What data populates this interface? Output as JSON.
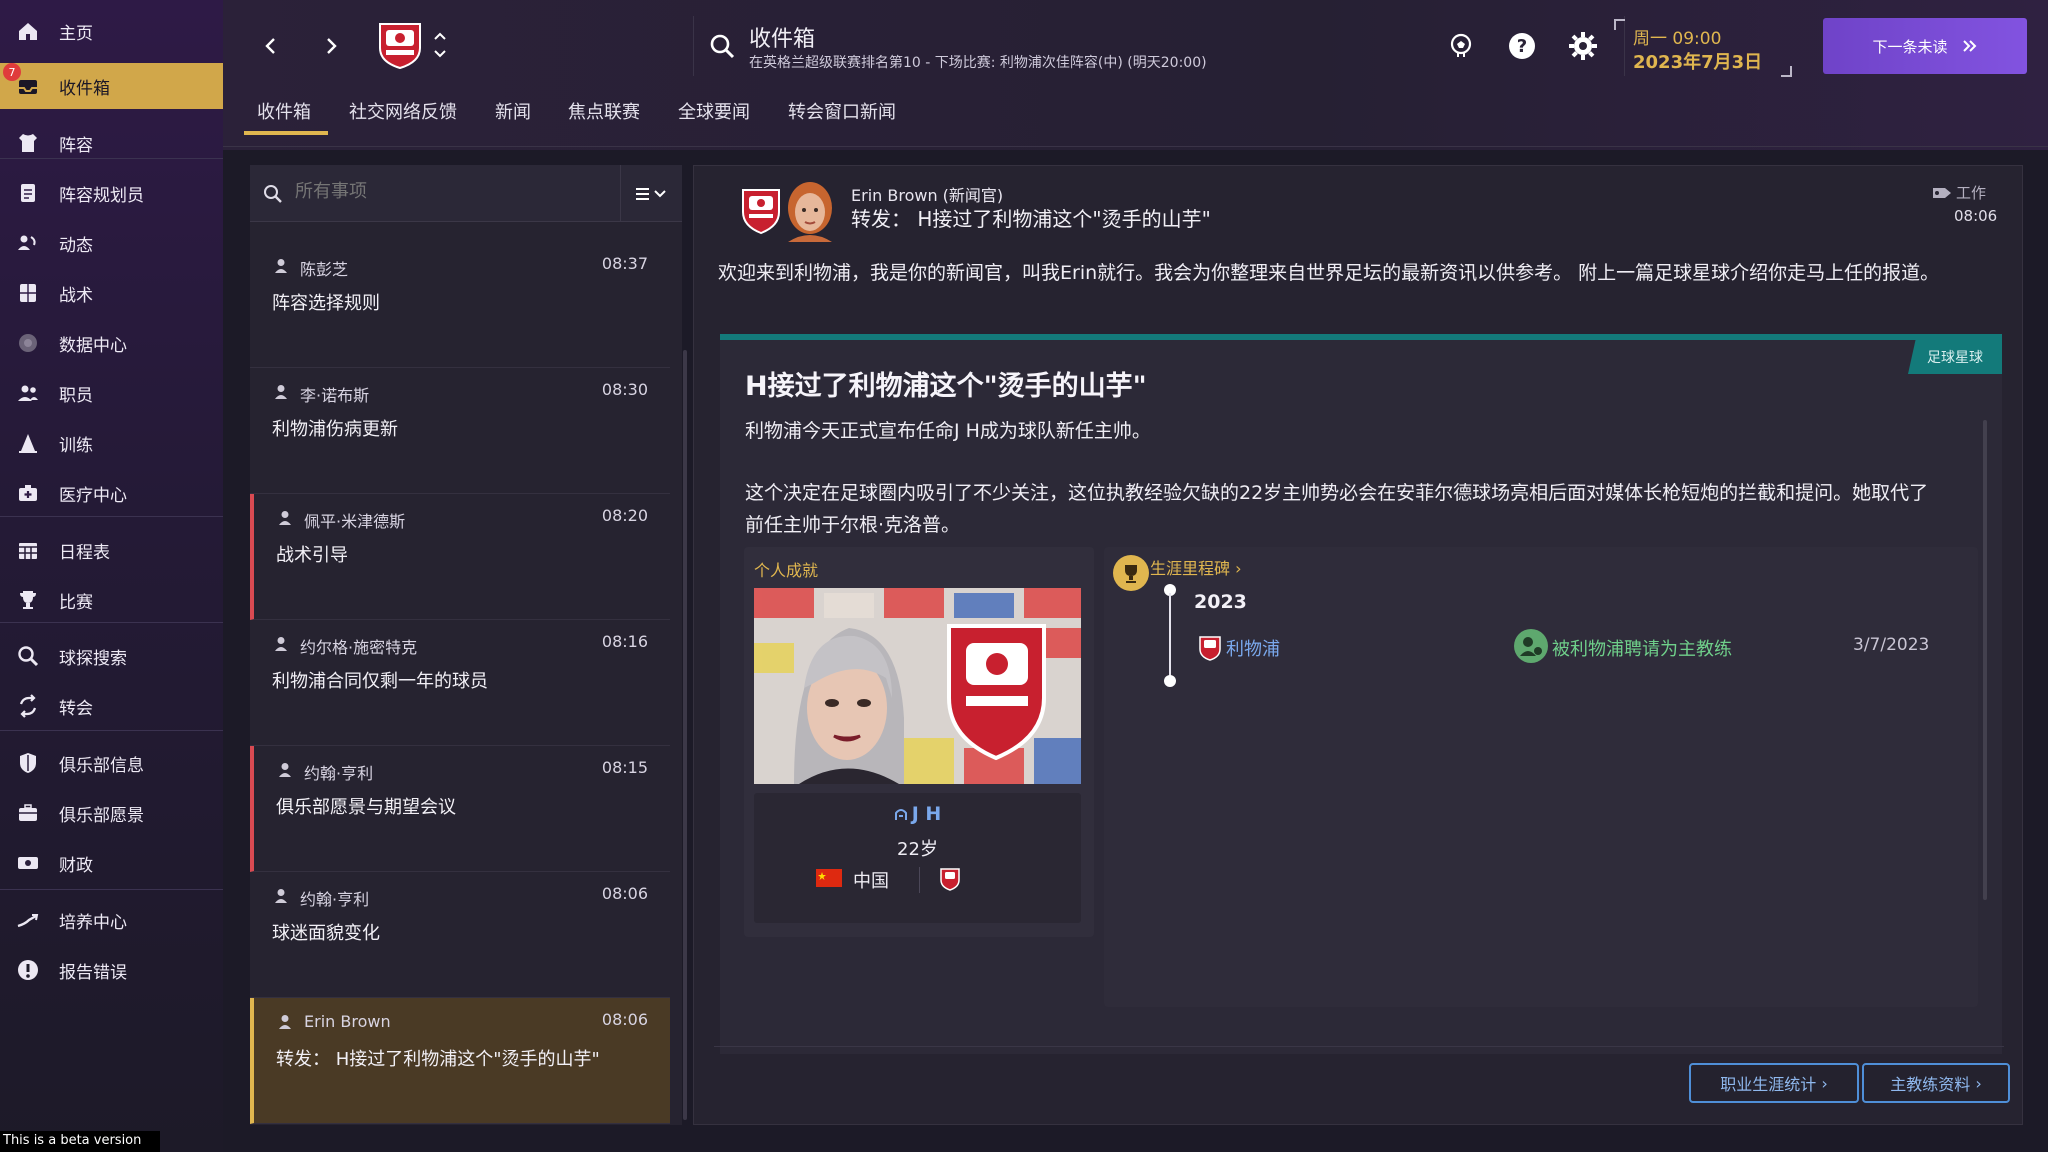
{
  "sidebar": {
    "badge": "7",
    "items": [
      {
        "label": "主页",
        "icon": "home-icon"
      },
      {
        "label": "收件箱",
        "icon": "inbox-icon"
      },
      {
        "label": "阵容",
        "icon": "shirt-icon"
      },
      {
        "label": "阵容规划员",
        "icon": "clipboard-icon"
      },
      {
        "label": "动态",
        "icon": "dynamics-icon"
      },
      {
        "label": "战术",
        "icon": "tactics-icon"
      },
      {
        "label": "数据中心",
        "icon": "data-hub-icon"
      },
      {
        "label": "职员",
        "icon": "staff-icon"
      },
      {
        "label": "训练",
        "icon": "training-cone-icon"
      },
      {
        "label": "医疗中心",
        "icon": "medical-kit-icon"
      },
      {
        "label": "日程表",
        "icon": "calendar-icon"
      },
      {
        "label": "比赛",
        "icon": "trophy-icon"
      },
      {
        "label": "球探搜索",
        "icon": "scouting-search-icon"
      },
      {
        "label": "转会",
        "icon": "transfer-arrows-icon"
      },
      {
        "label": "俱乐部信息",
        "icon": "shield-icon"
      },
      {
        "label": "俱乐部愿景",
        "icon": "briefcase-icon"
      },
      {
        "label": "财政",
        "icon": "finance-icon"
      },
      {
        "label": "培养中心",
        "icon": "development-icon"
      },
      {
        "label": "报告错误",
        "icon": "error-report-icon"
      }
    ],
    "beta": "This is a beta version"
  },
  "topbar": {
    "title": "收件箱",
    "subtitle": "在英格兰超级联赛排名第10 - 下场比赛: 利物浦次佳阵容(中) (明天20:00)",
    "day_time": "周一 09:00",
    "date": "2023年7月3日",
    "continue_label": "下一条未读"
  },
  "tabs": [
    "收件箱",
    "社交网络反馈",
    "新闻",
    "焦点联赛",
    "全球要闻",
    "转会窗口新闻"
  ],
  "list": {
    "search_placeholder": "所有事项",
    "messages": [
      {
        "sender": "陈彭芝",
        "time": "08:37",
        "subject": "阵容选择规则"
      },
      {
        "sender": "李·诺布斯",
        "time": "08:30",
        "subject": "利物浦伤病更新"
      },
      {
        "sender": "佩平·米津德斯",
        "time": "08:20",
        "subject": "战术引导"
      },
      {
        "sender": "约尔格·施密特克",
        "time": "08:16",
        "subject": "利物浦合同仅剩一年的球员"
      },
      {
        "sender": "约翰·亨利",
        "time": "08:15",
        "subject": "俱乐部愿景与期望会议"
      },
      {
        "sender": "约翰·亨利",
        "time": "08:06",
        "subject": "球迷面貌变化"
      },
      {
        "sender": "Erin Brown",
        "time": "08:06",
        "subject": "转发： H接过了利物浦这个\"烫手的山芋\""
      }
    ]
  },
  "detail": {
    "from": "Erin Brown (新闻官)",
    "subject": "转发： H接过了利物浦这个\"烫手的山芋\"",
    "tag": "工作",
    "time": "08:06",
    "intro": "欢迎来到利物浦，我是你的新闻官，叫我Erin就行。我会为你整理来自世界足坛的最新资讯以供参考。 附上一篇足球星球介绍你走马上任的报道。",
    "article": {
      "category": "足球星球",
      "title": "H接过了利物浦这个\"烫手的山芋\"",
      "p1": "利物浦今天正式宣布任命J H成为球队新任主帅。",
      "p2": "这个决定在足球圈内吸引了不少关注，这位执教经验欠缺的22岁主帅势必会在安菲尔德球场亮相后面对媒体长枪短炮的拦截和提问。她取代了前任主帅于尔根·克洛普。",
      "personal_title": "个人成就",
      "manager_name": "J H",
      "manager_age": "22岁",
      "manager_nation": "中国",
      "career_title": "生涯里程碑",
      "career_year": "2023",
      "career_club": "利物浦",
      "career_event": "被利物浦聘请为主教练",
      "career_date": "3/7/2023"
    },
    "bottom_buttons": [
      "职业生涯统计",
      "主教练资料"
    ]
  },
  "colors": {
    "accent_gold": "#e0b64f",
    "teal": "#137a7a",
    "purple_button": "#7a4ed8",
    "link_blue": "#7aa8ec",
    "flag_red": "#d94a52"
  }
}
